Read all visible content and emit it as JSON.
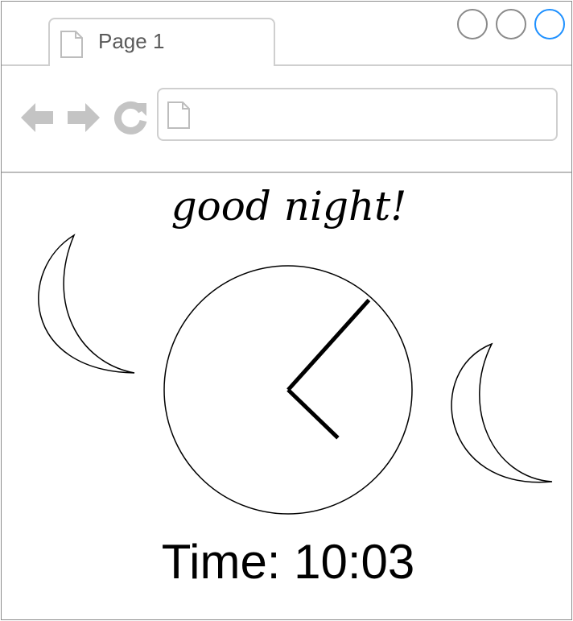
{
  "browser": {
    "tab": {
      "label": "Page 1"
    },
    "window_buttons": [
      "minimize",
      "maximize",
      "close"
    ],
    "window_button_colors": {
      "default": "#8a8a8a",
      "active": "#1e90ff"
    },
    "nav": {
      "back_icon": "arrow-left-icon",
      "forward_icon": "arrow-right-icon",
      "reload_icon": "reload-icon"
    },
    "address_bar": {
      "value": "",
      "placeholder": ""
    }
  },
  "content": {
    "greeting": "good night!",
    "clock": {
      "hours": 10,
      "minutes": 3
    },
    "time_label": "Time: 10:03",
    "decorations": [
      "crescent-moon-icon",
      "crescent-moon-icon"
    ]
  }
}
